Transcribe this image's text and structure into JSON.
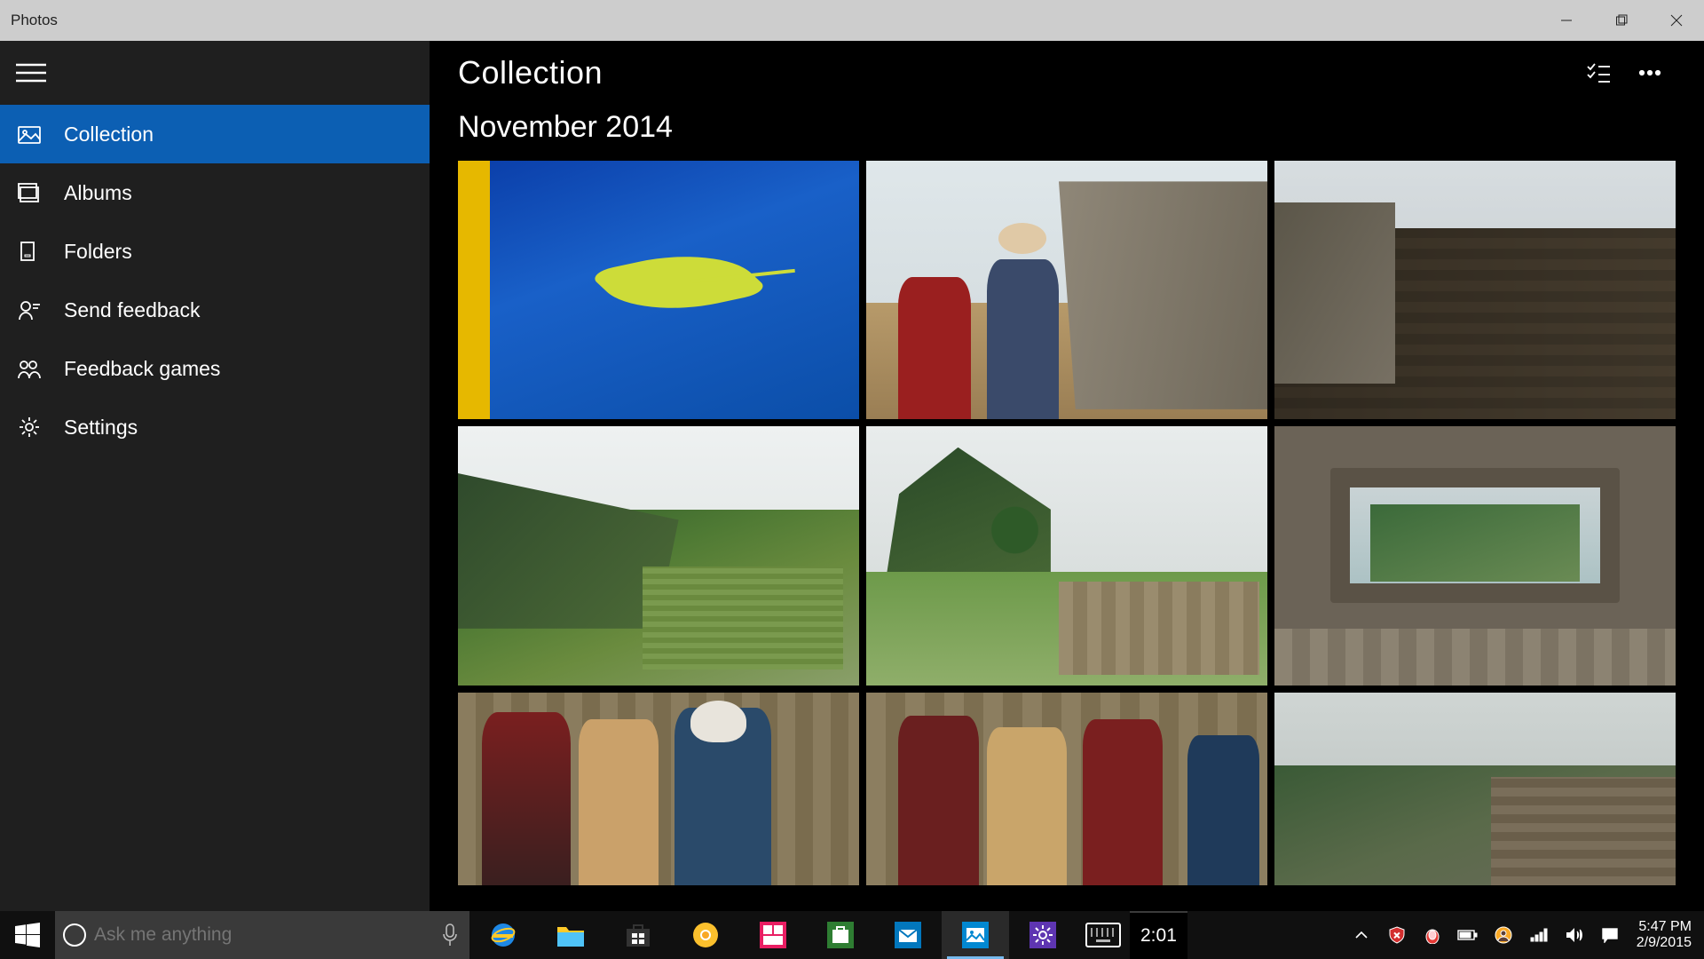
{
  "window": {
    "title": "Photos"
  },
  "sidebar": {
    "items": [
      {
        "label": "Collection",
        "icon": "collection-icon",
        "active": true
      },
      {
        "label": "Albums",
        "icon": "albums-icon",
        "active": false
      },
      {
        "label": "Folders",
        "icon": "folders-icon",
        "active": false
      },
      {
        "label": "Send feedback",
        "icon": "feedback-icon",
        "active": false
      },
      {
        "label": "Feedback games",
        "icon": "feedback-games-icon",
        "active": false
      },
      {
        "label": "Settings",
        "icon": "settings-icon",
        "active": false
      }
    ]
  },
  "content": {
    "header_title": "Collection",
    "date_group": "November 2014"
  },
  "taskbar": {
    "search_placeholder": "Ask me anything",
    "time_badge": "2:01",
    "clock_time": "5:47 PM",
    "clock_date": "2/9/2015"
  }
}
